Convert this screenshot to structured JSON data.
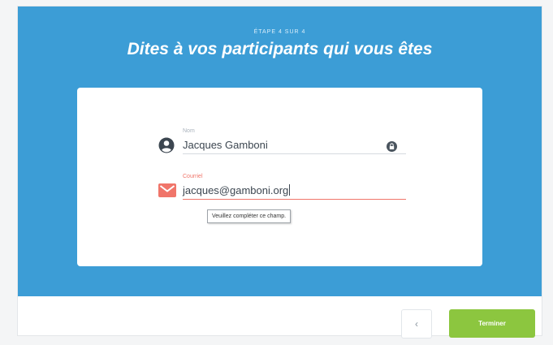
{
  "header": {
    "step": "ÉTAPE 4 SUR 4",
    "title": "Dites à vos participants qui vous êtes"
  },
  "form": {
    "name": {
      "label": "Nom",
      "value": "Jacques Gamboni",
      "icon": "user-icon",
      "trailing_icon": "lock-icon"
    },
    "email": {
      "label": "Courriel",
      "value": "jacques@gamboni.org",
      "icon": "mail-icon",
      "state": "error"
    }
  },
  "tooltip": {
    "text": "Veuillez compléter ce champ."
  },
  "footer": {
    "back_label": "‹",
    "finish_label": "Terminer"
  },
  "colors": {
    "hero_bg": "#3c9dd6",
    "finish_button": "#8cc63f",
    "error": "#f0756a",
    "icon_dark": "#3c4650"
  }
}
